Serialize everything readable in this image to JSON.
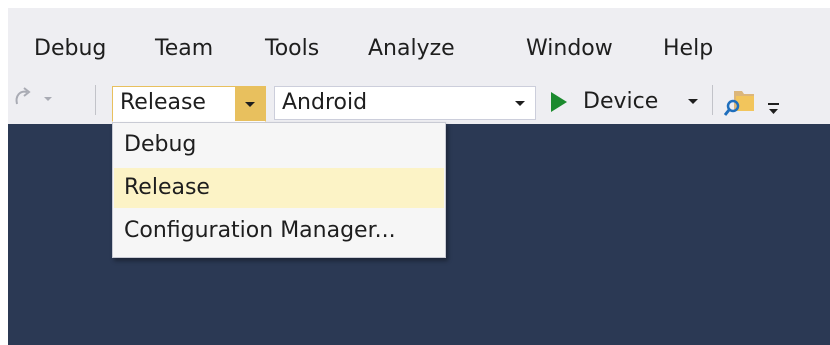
{
  "menu": {
    "items": [
      "Debug",
      "Team",
      "Tools",
      "Analyze",
      "Window",
      "Help"
    ]
  },
  "toolbar": {
    "configuration": {
      "value": "Release"
    },
    "platform": {
      "value": "Android"
    },
    "run": {
      "label": "Device"
    }
  },
  "configuration_dropdown": {
    "items": [
      "Debug",
      "Release",
      "Configuration Manager..."
    ],
    "selected": "Release"
  },
  "colors": {
    "editor_background": "#2b3954",
    "chrome_background": "#eeeef2",
    "accent": "#e8c05e",
    "selected_item": "#fcf3c6",
    "play_green": "#1b8a2e"
  },
  "icons": [
    "redo-icon",
    "chevron-down-icon",
    "play-icon",
    "folder-search-icon",
    "toolbar-overflow-icon"
  ]
}
